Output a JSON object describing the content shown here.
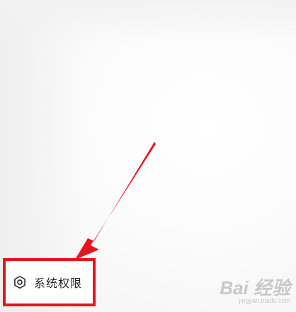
{
  "menu": {
    "item_label": "系统权限",
    "icon": "hexagon-settings-icon"
  },
  "annotation": {
    "color": "#e8141b"
  },
  "watermark": {
    "logo": "Bai 经验",
    "url": "jingyan.baidu.com"
  }
}
